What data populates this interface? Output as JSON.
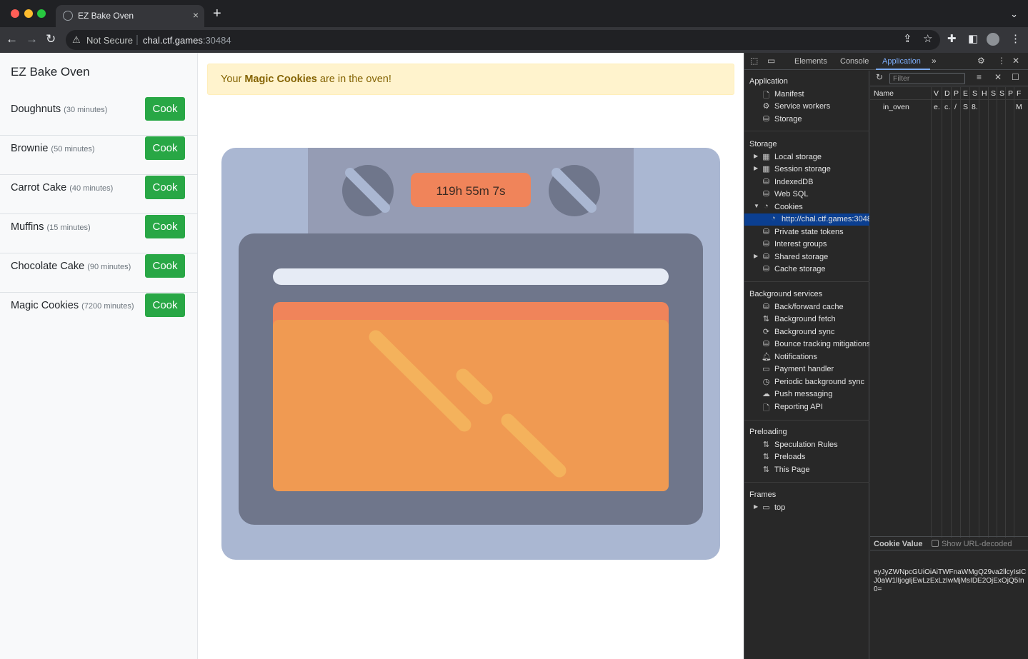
{
  "browser": {
    "tab_title": "EZ Bake Oven",
    "tab_close": "×",
    "new_tab": "+",
    "address_warning": "Not Secure",
    "address_host": "chal.ctf.games",
    "address_port": ":30484",
    "tab_list": "⌄"
  },
  "app": {
    "title": "EZ Bake Oven",
    "items": [
      {
        "name": "Doughnuts",
        "minutes": "(30 minutes)",
        "button": "Cook"
      },
      {
        "name": "Brownie",
        "minutes": "(50 minutes)",
        "button": "Cook"
      },
      {
        "name": "Carrot Cake",
        "minutes": "(40 minutes)",
        "button": "Cook"
      },
      {
        "name": "Muffins",
        "minutes": "(15 minutes)",
        "button": "Cook"
      },
      {
        "name": "Chocolate Cake",
        "minutes": "(90 minutes)",
        "button": "Cook"
      },
      {
        "name": "Magic Cookies",
        "minutes": "(7200 minutes)",
        "button": "Cook"
      }
    ],
    "alert_prefix": "Your ",
    "alert_bold": "Magic Cookies",
    "alert_suffix": " are in the oven!",
    "timer": "119h 55m 7s"
  },
  "devtools": {
    "tabs": [
      "Elements",
      "Console",
      "Application"
    ],
    "active_tab": "Application",
    "filter_placeholder": "Filter",
    "sections": {
      "application": "Application",
      "storage": "Storage",
      "background": "Background services",
      "preloading": "Preloading",
      "frames": "Frames"
    },
    "application_items": [
      "Manifest",
      "Service workers",
      "Storage"
    ],
    "storage_items": [
      "Local storage",
      "Session storage",
      "IndexedDB",
      "Web SQL",
      "Cookies",
      "http://chal.ctf.games:30484",
      "Private state tokens",
      "Interest groups",
      "Shared storage",
      "Cache storage"
    ],
    "background_items": [
      "Back/forward cache",
      "Background fetch",
      "Background sync",
      "Bounce tracking mitigations",
      "Notifications",
      "Payment handler",
      "Periodic background sync",
      "Push messaging",
      "Reporting API"
    ],
    "preloading_items": [
      "Speculation Rules",
      "Preloads",
      "This Page"
    ],
    "frames_items": [
      "top"
    ],
    "cookie_table": {
      "columns": [
        "Name",
        "V",
        "D",
        "P",
        "E",
        "S",
        "H",
        "S",
        "S",
        "P",
        "F"
      ],
      "row": [
        "in_oven",
        "e.",
        "c.",
        "/",
        "S",
        "8.",
        "M"
      ]
    },
    "cookie_value_label": "Cookie Value",
    "show_decoded_label": "Show URL-decoded",
    "cookie_value": "eyJyZWNpcGUiOiAiTWFnaWMgQ29va2llcyIsICJ0aW1lIjogIjEwLzExLzIwMjMsIDE2OjExOjQ5In0="
  },
  "colors": {
    "cook_button": "#28a745",
    "alert_bg": "#fff3cd",
    "alert_text": "#856404",
    "oven_body": "#aab7d2",
    "oven_panel": "#959cb4",
    "oven_door": "#6f768b",
    "oven_window": "#f09a52",
    "timer_bg": "#f0845a",
    "devtools_accent": "#7cacf8"
  }
}
